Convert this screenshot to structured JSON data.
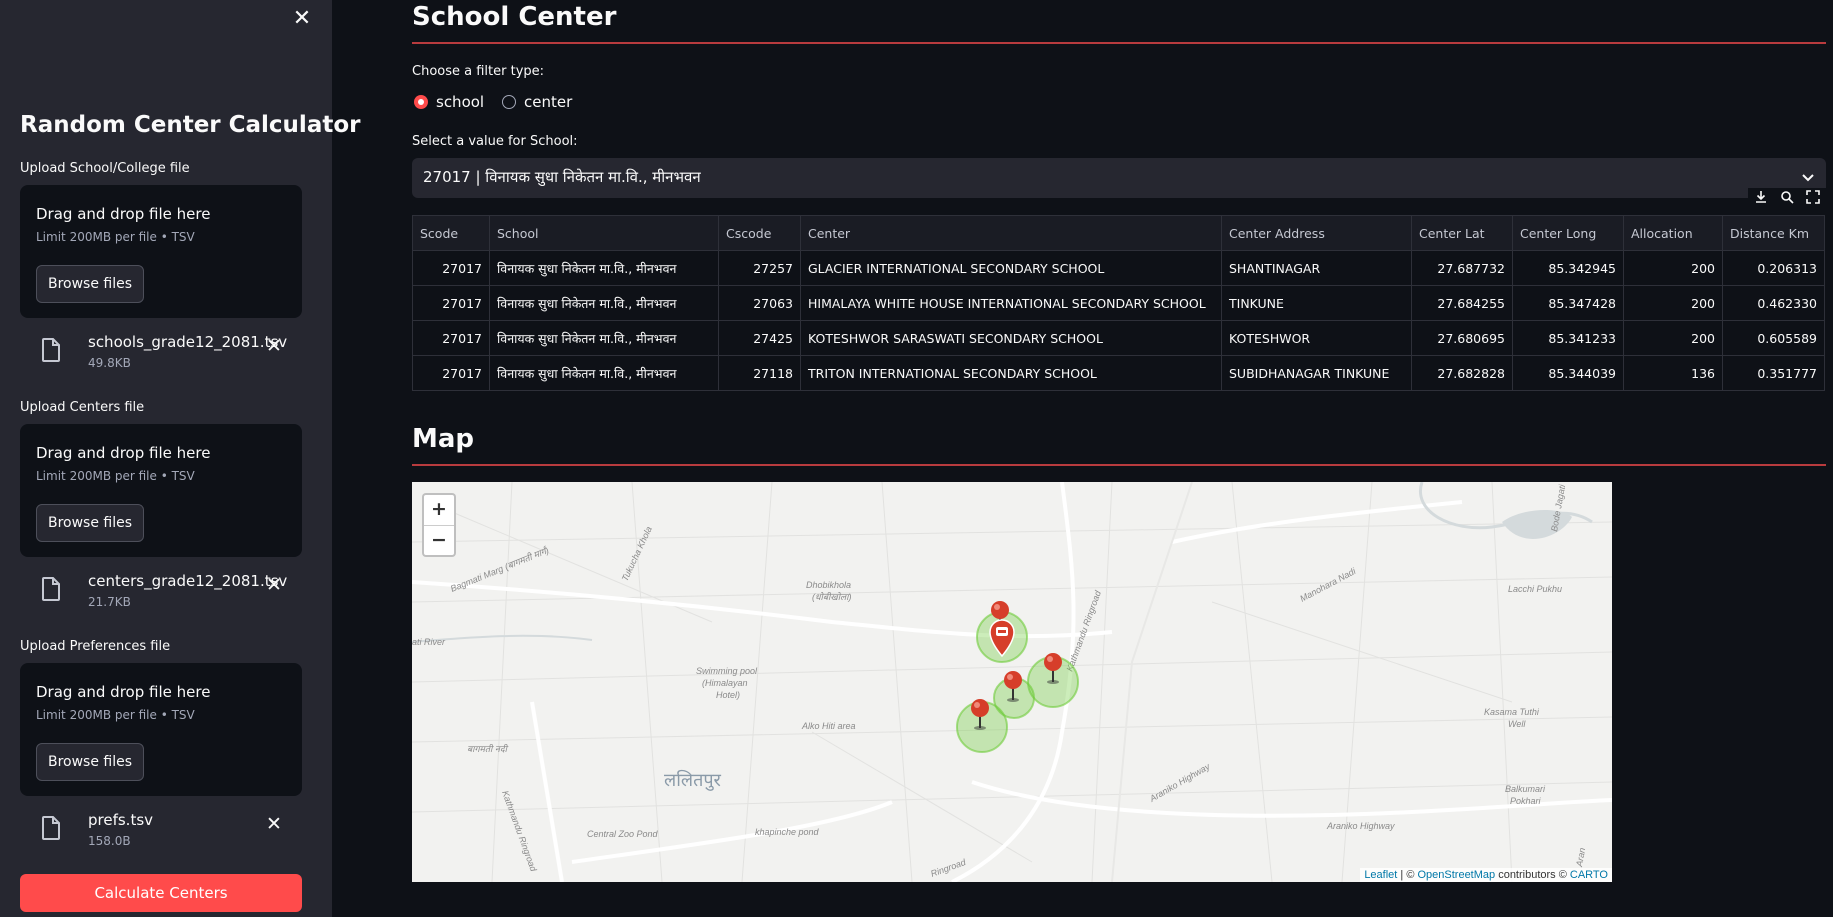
{
  "sidebar": {
    "close_icon": "close-icon",
    "title": "Random Center Calculator",
    "uploads": [
      {
        "label": "Upload School/College file",
        "drop_text": "Drag and drop file here",
        "limit": "Limit 200MB per file • TSV",
        "button": "Browse files",
        "file_name": "schools_grade12_2081.tsv",
        "file_size": "49.8KB"
      },
      {
        "label": "Upload Centers file",
        "drop_text": "Drag and drop file here",
        "limit": "Limit 200MB per file • TSV",
        "button": "Browse files",
        "file_name": "centers_grade12_2081.tsv",
        "file_size": "21.7KB"
      },
      {
        "label": "Upload Preferences file",
        "drop_text": "Drag and drop file here",
        "limit": "Limit 200MB per file • TSV",
        "button": "Browse files",
        "file_name": "prefs.tsv",
        "file_size": "158.0B"
      }
    ],
    "calc_button": "Calculate Centers"
  },
  "main": {
    "title": "School Center",
    "filter_label": "Choose a filter type:",
    "filter_options": [
      "school",
      "center"
    ],
    "filter_selected": "school",
    "select_label": "Select a value for School:",
    "select_value": "27017 | विनायक सुधा निकेतन मा.वि., मीनभवन",
    "table": {
      "columns": [
        "Scode",
        "School",
        "Cscode",
        "Center",
        "Center Address",
        "Center Lat",
        "Center Long",
        "Allocation",
        "Distance Km"
      ],
      "rows": [
        [
          "27017",
          "विनायक सुधा निकेतन मा.वि., मीनभवन",
          "27257",
          "GLACIER INTERNATIONAL SECONDARY SCHOOL",
          "SHANTINAGAR",
          "27.687732",
          "85.342945",
          "200",
          "0.206313"
        ],
        [
          "27017",
          "विनायक सुधा निकेतन मा.वि., मीनभवन",
          "27063",
          "HIMALAYA WHITE HOUSE INTERNATIONAL SECONDARY SCHOOL",
          "TINKUNE",
          "27.684255",
          "85.347428",
          "200",
          "0.462330"
        ],
        [
          "27017",
          "विनायक सुधा निकेतन मा.वि., मीनभवन",
          "27425",
          "KOTESHWOR SARASWATI SECONDARY SCHOOL",
          "KOTESHWOR",
          "27.680695",
          "85.341233",
          "200",
          "0.605589"
        ],
        [
          "27017",
          "विनायक सुधा निकेतन मा.वि., मीनभवन",
          "27118",
          "TRITON INTERNATIONAL SECONDARY SCHOOL",
          "SUBIDHANAGAR TINKUNE",
          "27.682828",
          "85.344039",
          "136",
          "0.351777"
        ]
      ]
    },
    "map_title": "Map",
    "map": {
      "zoom_in": "+",
      "zoom_out": "−",
      "attribution": {
        "leaflet": "Leaflet",
        "sep": " | © ",
        "osm": "OpenStreetMap",
        "contrib": " contributors © ",
        "carto": "CARTO"
      },
      "labels": {
        "dhobikhola": "Dhobikhola",
        "dhobikhola_np": "(धोबीखोला)",
        "bagmati_rd": "Bagmati Marg (बागमती मार्ग)",
        "tukucha": "Tukucha Khola",
        "ringroad": "Kathmandu Ringroad",
        "manohara": "Manohara Nadi",
        "lacchi": "Lacchi Pukhu",
        "river": "ati River",
        "swimming": "Swimming pool",
        "himalayan": "(Himalayan",
        "hotel": "Hotel)",
        "alko": "Alko Hiti area",
        "lalitpur": "ललितपुर",
        "bagmati_np": "बागमती नदी",
        "kasama": "Kasama Tuthi",
        "well": "Well",
        "araniko1": "Araniko Highway",
        "araniko2": "Araniko Highway",
        "balkumari": "Balkumari",
        "pokhari": "Pokhari",
        "zoo": "Central Zoo Pond",
        "khapinche": "khapinche pond",
        "ringroad2": "Ringroad",
        "kathmandu_rr": "Kathmandu Ringroad",
        "bode": "Bode Jagati",
        "aran": "Aran"
      }
    }
  },
  "colors": {
    "accent": "#ff4b4b",
    "sidebar": "#262730",
    "background": "#0e1117",
    "marker": "#d63e2a",
    "cluster": "#6ecc39"
  },
  "icons": [
    "close-icon",
    "file-icon",
    "chevron-down-icon",
    "download-icon",
    "search-icon",
    "fullscreen-icon",
    "map-marker-icon",
    "school-marker-icon"
  ]
}
